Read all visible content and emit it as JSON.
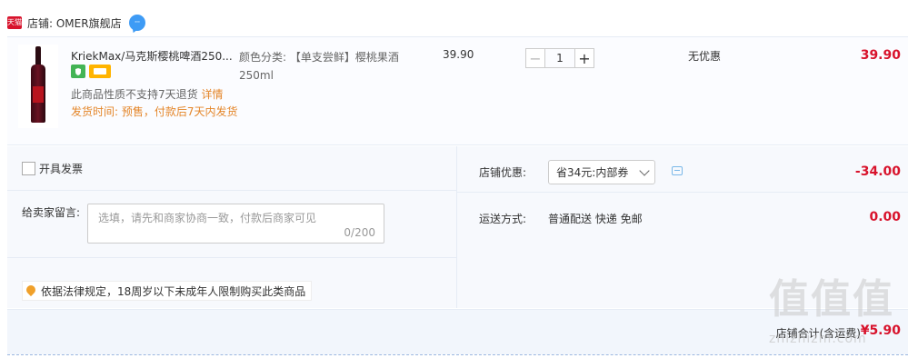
{
  "shop": {
    "badge": "天猫",
    "name": "店铺: OMER旗舰店",
    "chat_dots": "···"
  },
  "item": {
    "title": "KriekMax/马克斯樱桃啤酒250...",
    "return_note": "此商品性质不支持7天退货",
    "return_link": "详情",
    "ship_time": "发货时间: 预售，付款后7天内发货",
    "sku": "颜色分类: 【单支尝鲜】樱桃果酒250ml",
    "unit_price": "39.90",
    "quantity": "1",
    "minus": "−",
    "plus": "+",
    "discount": "无优惠",
    "subtotal": "39.90"
  },
  "extras": {
    "invoice_label": "开具发票",
    "message_label": "给卖家留言:",
    "message_placeholder": "选填，请先和商家协商一致，付款后商家可见",
    "message_count": "0/200",
    "legal_notice": "依据法律规定，18周岁以下未成年人限制购买此类商品"
  },
  "shop_discount": {
    "label": "店铺优惠:",
    "selected": "省34元:内部券",
    "amount": "-34.00"
  },
  "shipping": {
    "label": "运送方式:",
    "method": "普通配送 快递 免邮",
    "fee": "0.00"
  },
  "total": {
    "label": "店铺合计(含运费)",
    "amount": "¥5.90"
  },
  "watermark": {
    "logo": "值值值",
    "site": "zhizhizhi.com"
  },
  "colors": {
    "price_red": "#d8132c",
    "notice_orange": "#e4862a",
    "panel_bg": "#fbfcff",
    "tmall_red": "#d8132c",
    "chat_blue": "#3e9bf5"
  }
}
